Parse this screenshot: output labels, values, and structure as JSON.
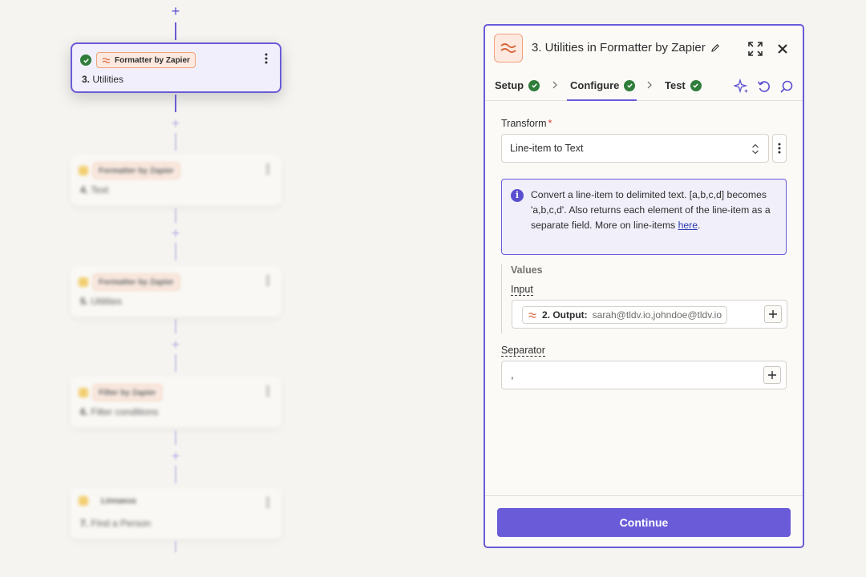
{
  "canvas": {
    "steps": [
      {
        "app": "Formatter by Zapier",
        "number": "3.",
        "name": "Utilities",
        "status": "complete"
      },
      {
        "app": "Formatter by Zapier",
        "number": "4.",
        "name": "Text"
      },
      {
        "app": "Formatter by Zapier",
        "number": "5.",
        "name": "Utilities"
      },
      {
        "app": "Filter by Zapier",
        "number": "6.",
        "name": "Filter conditions"
      },
      {
        "app": "Linnaeus",
        "number": "7.",
        "name": "Find a Person"
      }
    ]
  },
  "panel": {
    "title": "3. Utilities in Formatter by Zapier",
    "tabs": [
      {
        "label": "Setup",
        "status": "complete"
      },
      {
        "label": "Configure",
        "status": "complete",
        "active": true
      },
      {
        "label": "Test",
        "status": "complete"
      }
    ],
    "transform": {
      "label": "Transform",
      "required_mark": "*",
      "value": "Line-item to Text"
    },
    "info": {
      "icon_char": "i",
      "text": "Convert a line-item to delimited text. [a,b,c,d] becomes 'a,b,c,d'. Also returns each element of the line-item as a separate field. More on line-items ",
      "link": "here",
      "after_link": "."
    },
    "values": {
      "title": "Values",
      "input_label": "Input",
      "pill_label": "2. Output:",
      "pill_value": "sarah@tldv.io,johndoe@tldv.io"
    },
    "separator": {
      "label": "Separator",
      "value": ","
    },
    "continue_label": "Continue"
  },
  "colors": {
    "accent": "#6a5bd8",
    "success": "#2f7d3b",
    "formatter_orange": "#f0a27c",
    "background": "#f5f4f0"
  }
}
